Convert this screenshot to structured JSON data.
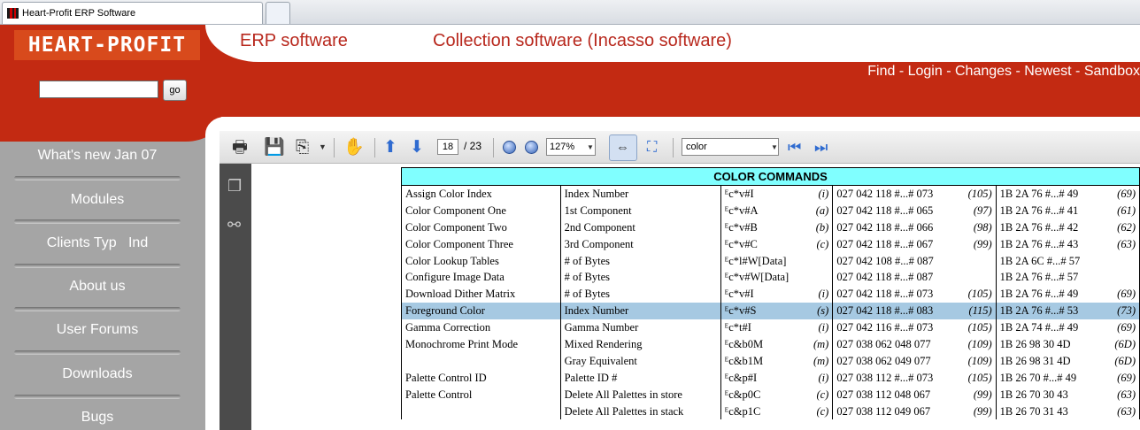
{
  "browser": {
    "tab_title": "Heart-Profit ERP Software"
  },
  "header": {
    "logo_text": "HEART-PROFIT",
    "link_erp": "ERP software",
    "link_collection": "Collection software (Incasso software)",
    "top_links": [
      "Find",
      "Login",
      "Changes",
      "Newest",
      "Sandbox"
    ],
    "top_links_sep": " - ",
    "search_value": "",
    "go_label": "go"
  },
  "sidebar": {
    "items": [
      {
        "label": "What's new Jan 07"
      },
      {
        "label": "Modules"
      },
      {
        "label": "Clients Typ   Ind"
      },
      {
        "label": "About us"
      },
      {
        "label": "User Forums"
      },
      {
        "label": "Downloads"
      },
      {
        "label": "Bugs"
      }
    ]
  },
  "pdf_toolbar": {
    "page_current": "18",
    "page_total": "/ 23",
    "zoom": "127%",
    "find_value": "color"
  },
  "table": {
    "title": "COLOR COMMANDS",
    "rows": [
      {
        "func": "Assign Color Index",
        "param": "Index Number",
        "esc": "ᴱc*v#I",
        "code": "(i)",
        "dec": "027 042 118 #...# 073",
        "decp": "(105)",
        "hex": "1B 2A 76 #...# 49",
        "hexp": "(69)"
      },
      {
        "func": "Color Component One",
        "param": "1st Component",
        "esc": "ᴱc*v#A",
        "code": "(a)",
        "dec": "027 042 118 #...# 065",
        "decp": "(97)",
        "hex": "1B 2A 76 #...# 41",
        "hexp": "(61)"
      },
      {
        "func": "Color Component Two",
        "param": "2nd Component",
        "esc": "ᴱc*v#B",
        "code": "(b)",
        "dec": "027 042 118 #...# 066",
        "decp": "(98)",
        "hex": "1B 2A 76 #...# 42",
        "hexp": "(62)"
      },
      {
        "func": "Color Component Three",
        "param": "3rd Component",
        "esc": "ᴱc*v#C",
        "code": "(c)",
        "dec": "027 042 118 #...# 067",
        "decp": "(99)",
        "hex": "1B 2A 76 #...# 43",
        "hexp": "(63)"
      },
      {
        "func": "Color Lookup Tables",
        "param": "# of Bytes",
        "esc": "ᴱc*l#W[Data]",
        "code": "",
        "dec": "027 042 108 #...# 087",
        "decp": "",
        "hex": "1B 2A 6C #...# 57",
        "hexp": ""
      },
      {
        "func": "Configure Image Data",
        "param": "# of Bytes",
        "esc": "ᴱc*v#W[Data]",
        "code": "",
        "dec": "027 042 118 #...# 087",
        "decp": "",
        "hex": "1B 2A 76 #...# 57",
        "hexp": ""
      },
      {
        "func": "Download Dither Matrix",
        "param": "# of Bytes",
        "esc": "ᴱc*v#I",
        "code": "(i)",
        "dec": "027 042 118 #...# 073",
        "decp": "(105)",
        "hex": "1B 2A 76 #...# 49",
        "hexp": "(69)"
      },
      {
        "func": "Foreground Color",
        "param": "Index Number",
        "esc": "ᴱc*v#S",
        "code": "(s)",
        "dec": "027 042 118 #...# 083",
        "decp": "(115)",
        "hex": "1B 2A 76 #...# 53",
        "hexp": "(73)",
        "highlight": true
      },
      {
        "func": "Gamma Correction",
        "param": "Gamma Number",
        "esc": "ᴱc*t#I",
        "code": "(i)",
        "dec": "027 042 116 #...# 073",
        "decp": "(105)",
        "hex": "1B 2A 74 #...# 49",
        "hexp": "(69)"
      },
      {
        "func": "Monochrome Print Mode",
        "param": "Mixed Rendering",
        "esc": "ᴱc&b0M",
        "code": "(m)",
        "dec": "027 038 062 048 077",
        "decp": "(109)",
        "hex": "1B 26 98 30 4D",
        "hexp": "(6D)"
      },
      {
        "func": "",
        "param": "Gray Equivalent",
        "esc": "ᴱc&b1M",
        "code": "(m)",
        "dec": "027 038 062 049 077",
        "decp": "(109)",
        "hex": "1B 26 98 31 4D",
        "hexp": "(6D)"
      },
      {
        "func": "Palette Control ID",
        "param": "Palette ID #",
        "esc": "ᴱc&p#I",
        "code": "(i)",
        "dec": "027 038 112 #...# 073",
        "decp": "(105)",
        "hex": "1B 26 70 #...# 49",
        "hexp": "(69)"
      },
      {
        "func": "Palette Control",
        "param": "Delete All Palettes in store",
        "esc": "ᴱc&p0C",
        "code": "(c)",
        "dec": "027 038 112 048 067",
        "decp": "(99)",
        "hex": "1B 26 70 30 43",
        "hexp": "(63)"
      },
      {
        "func": "",
        "param": "Delete All Palettes in stack",
        "esc": "ᴱc&p1C",
        "code": "(c)",
        "dec": "027 038 112 049 067",
        "decp": "(99)",
        "hex": "1B 26 70 31 43",
        "hexp": "(63)"
      }
    ]
  }
}
